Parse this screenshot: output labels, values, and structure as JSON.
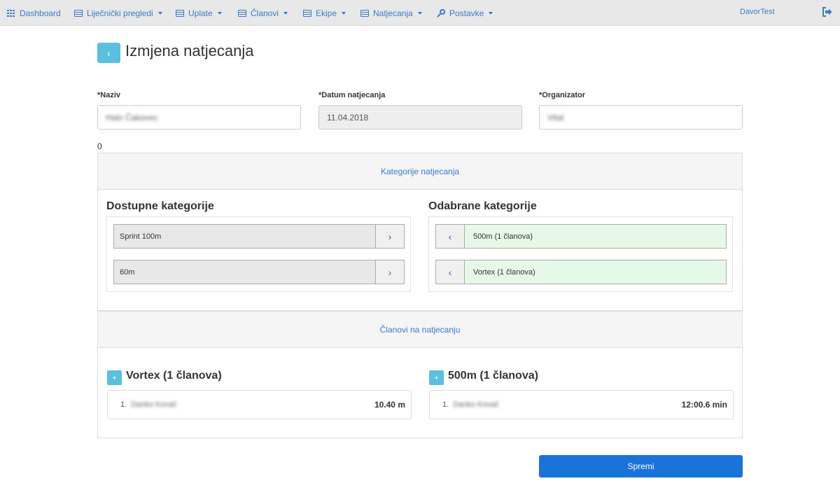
{
  "nav": {
    "items": [
      {
        "label": "Dashboard",
        "icon": "grid-icon",
        "dropdown": false
      },
      {
        "label": "Liječnički pregledi",
        "icon": "table-icon",
        "dropdown": true
      },
      {
        "label": "Uplate",
        "icon": "table-icon",
        "dropdown": true
      },
      {
        "label": "Članovi",
        "icon": "table-icon",
        "dropdown": true
      },
      {
        "label": "Ekipe",
        "icon": "table-icon",
        "dropdown": true
      },
      {
        "label": "Natjecanja",
        "icon": "table-icon",
        "dropdown": true
      },
      {
        "label": "Postavke",
        "icon": "wrench-icon",
        "dropdown": true
      }
    ],
    "user": "DavorTest",
    "logout_icon": "sign-out-icon"
  },
  "header": {
    "back_label": "‹",
    "title": "Izmjena natjecanja"
  },
  "form": {
    "naziv_label": "*Naziv",
    "naziv_value": "Halo Čakovec",
    "datum_label": "*Datum natjecanja",
    "datum_value": "11.04.2018",
    "organizator_label": "*Organizator",
    "organizator_value": "Vital"
  },
  "zero_text": "0",
  "categories_panel": {
    "title": "Kategorije natjecanja",
    "available_heading": "Dostupne kategorije",
    "selected_heading": "Odabrane kategorije",
    "available": [
      "Sprint 100m",
      "60m"
    ],
    "selected": [
      "500m (1 članova)",
      "Vortex (1 članova)"
    ]
  },
  "members_panel": {
    "title": "Članovi na natjecanju",
    "groups": [
      {
        "title": "Vortex (1 članova)",
        "members": [
          {
            "num": "1.",
            "name": "Danko Kovač",
            "result": "10.40 m"
          }
        ]
      },
      {
        "title": "500m (1 članova)",
        "members": [
          {
            "num": "1.",
            "name": "Danko Kovač",
            "result": "12:00.6 min"
          }
        ]
      }
    ]
  },
  "save_label": "Spremi",
  "colors": {
    "accent": "#3a7bc8",
    "info": "#5bc0de",
    "primary": "#1a73d9",
    "selected_bg": "#e6f9e8"
  }
}
